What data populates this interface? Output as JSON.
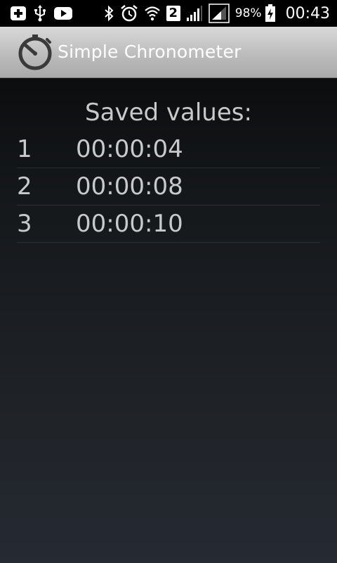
{
  "status_bar": {
    "battery_percent": "98%",
    "time": "00:43",
    "sim_slot": "2",
    "icons": [
      "plus-icon",
      "usb-icon",
      "youtube-icon",
      "bluetooth-icon",
      "alarm-icon",
      "wifi-icon",
      "sim-2-icon",
      "signal-icon",
      "signal-icon-2",
      "battery-charging-icon"
    ]
  },
  "action_bar": {
    "title": "Simple Chronometer",
    "icon": "stopwatch-icon"
  },
  "main": {
    "heading": "Saved values:",
    "saved_values": [
      {
        "index": "1",
        "time": "00:00:04"
      },
      {
        "index": "2",
        "time": "00:00:08"
      },
      {
        "index": "3",
        "time": "00:00:10"
      }
    ]
  },
  "colors": {
    "action_bar_top": "#d9d9d9",
    "action_bar_bottom": "#a9a9a9",
    "text_primary": "#c7c9cb",
    "background_top": "#050607",
    "background_bottom": "#252a33"
  }
}
